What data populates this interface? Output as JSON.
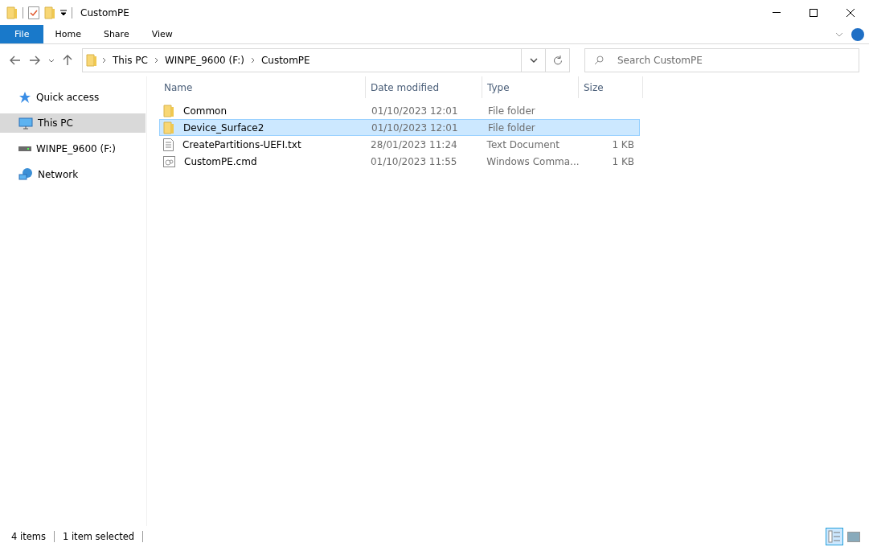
{
  "window": {
    "title": "CustomPE"
  },
  "ribbon_tabs": [
    {
      "label": "File",
      "kind": "file",
      "selected": false
    },
    {
      "label": "Home",
      "kind": "tab",
      "selected": false
    },
    {
      "label": "Share",
      "kind": "tab",
      "selected": false
    },
    {
      "label": "View",
      "kind": "tab",
      "selected": false
    }
  ],
  "address_bar": {
    "crumbs": [
      "This PC",
      "WINPE_9600 (F:)",
      "CustomPE"
    ]
  },
  "search": {
    "placeholder": "Search CustomPE"
  },
  "sidebar": {
    "items": [
      {
        "label": "Quick access",
        "kind": "star",
        "selected": false
      },
      {
        "label": "This PC",
        "kind": "pc",
        "selected": true
      },
      {
        "label": "WINPE_9600 (F:)",
        "kind": "drive",
        "selected": false
      },
      {
        "label": "Network",
        "kind": "network",
        "selected": false
      }
    ]
  },
  "table": {
    "columns": [
      "Name",
      "Date modified",
      "Type",
      "Size"
    ],
    "rows": [
      {
        "name": "Common",
        "date": "01/10/2023 12:01",
        "type": "File folder",
        "kind": "folder",
        "selected": false
      },
      {
        "name": "Device_Surface2",
        "date": "01/10/2023 12:01",
        "type": "File folder",
        "kind": "folder",
        "selected": true
      },
      {
        "name": "CreatePartitions-UEFI.txt",
        "date": "28/01/2023 11:24",
        "type": "Text Document",
        "size": "1 KB",
        "kind": "text",
        "selected": false
      },
      {
        "name": "CustomPE.cmd",
        "date": "01/10/2023 11:55",
        "type": "Windows Comma...",
        "size": "1 KB",
        "kind": "cmd",
        "selected": false
      }
    ]
  },
  "status_bar": {
    "count": "4 items",
    "selection": "1 item selected"
  },
  "view_modes": [
    {
      "kind": "details",
      "selected": true
    },
    {
      "kind": "thumbnails",
      "selected": false
    }
  ]
}
